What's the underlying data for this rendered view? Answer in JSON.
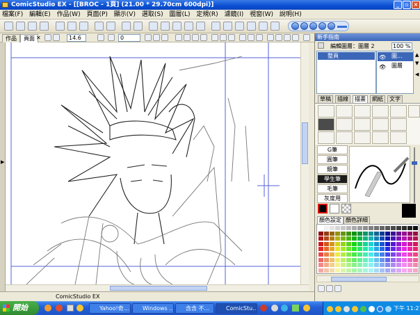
{
  "window": {
    "title": "ComicStudio EX - [[BROC - 1頁] (21.00 * 29.70cm 600dpi)]"
  },
  "menu": [
    "檔案(F)",
    "編輯(E)",
    "作品(W)",
    "頁面(P)",
    "顯示(V)",
    "選取(S)",
    "圖層(L)",
    "定規(R)",
    "濾鏡(I)",
    "視窗(W)",
    "說明(H)"
  ],
  "doc_tabs": [
    "作品",
    "頁面"
  ],
  "toolbar2": {
    "brush_size": "14.6",
    "rotation": "0"
  },
  "panel": {
    "title": "新手指南",
    "layer_edit_label": "編輯圖層：圖層 2",
    "zoom": "100 %",
    "page_item": "整頁",
    "layers": [
      "圖...",
      "圖層"
    ],
    "tool_tabs": [
      "草稿",
      "描線",
      "描畫",
      "網紙",
      "文字"
    ],
    "active_tool_tab": "描畫",
    "pen_types": [
      "G筆",
      "圓筆",
      "鏡筆",
      "學生筆",
      "毛筆",
      "灰度用"
    ],
    "active_pen": "學生筆",
    "color_tabs": [
      "顏色設定",
      "顏色詳細"
    ]
  },
  "status": {
    "text": "ComicStudio EX"
  },
  "taskbar": {
    "start_label": "開始",
    "tasks": [
      "Yahoo!奇...",
      "Windows ...",
      "含含 不...",
      "ComicStu..."
    ],
    "clock": "下午 11:21"
  },
  "colors": {
    "title_blue": "#0a4fd3",
    "taskbar_blue": "#245fd6",
    "start_green": "#3f9e40",
    "guide_blue": "#5560d8"
  }
}
